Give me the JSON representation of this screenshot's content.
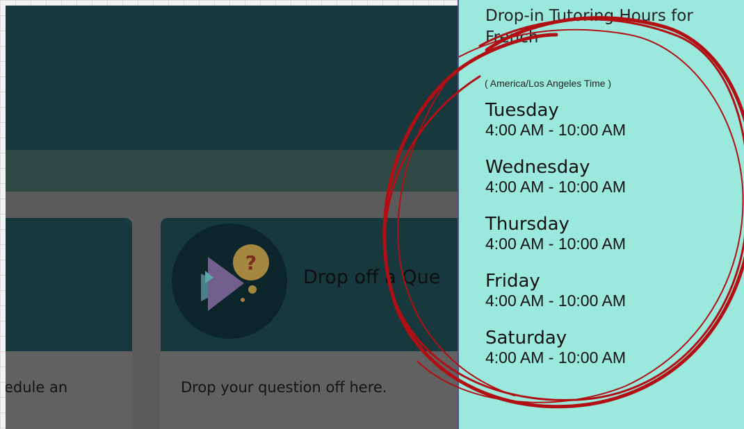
{
  "left_page": {
    "card_left_body": "edule an",
    "card_right_title": "Drop off a Que",
    "card_right_body": "Drop your question off here."
  },
  "panel": {
    "title": "Drop-in Tutoring Hours for French",
    "timezone": "( America/Los Angeles Time )",
    "schedule": [
      {
        "day": "Tuesday",
        "hours": "4:00 AM - 10:00 AM"
      },
      {
        "day": "Wednesday",
        "hours": "4:00 AM - 10:00 AM"
      },
      {
        "day": "Thursday",
        "hours": "4:00 AM - 10:00 AM"
      },
      {
        "day": "Friday",
        "hours": "4:00 AM - 10:00 AM"
      },
      {
        "day": "Saturday",
        "hours": "4:00 AM - 10:00 AM"
      }
    ]
  },
  "colors": {
    "panel_bg": "#9be9dc",
    "scribble": "#b10f14",
    "header_dark": "#17393d",
    "overlay_gray": "#5b5b5b"
  },
  "icons": {
    "fish": "fish-question-icon",
    "question": "question-mark-icon"
  }
}
